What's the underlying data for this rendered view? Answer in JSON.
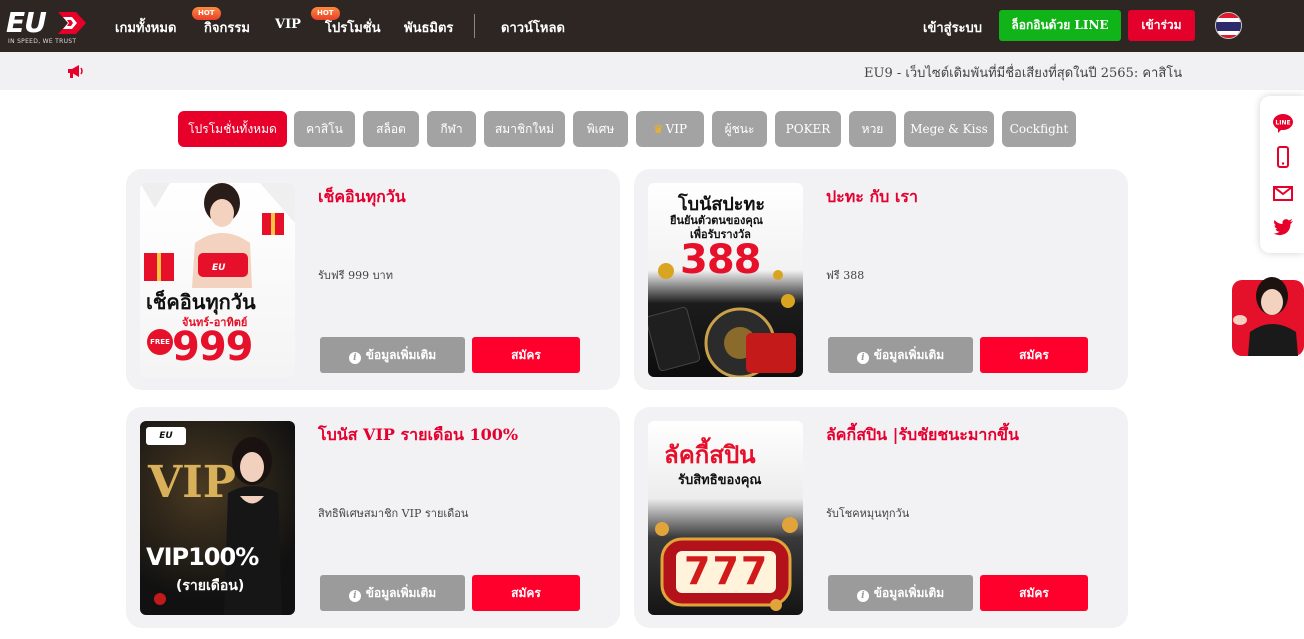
{
  "header": {
    "logo_text": "EU",
    "logo_tagline": "IN SPEED, WE TRUST",
    "nav": [
      {
        "label": "เกมทั้งหมด"
      },
      {
        "label": "กิจกรรม",
        "badge": "HOT"
      },
      {
        "label": "VIP"
      },
      {
        "label": "โปรโมชั่น",
        "badge": "HOT"
      },
      {
        "label": "พันธมิตร"
      },
      {
        "label": "ดาวน์โหลด"
      }
    ],
    "login_label": "เข้าสู่ระบบ",
    "line_login_label": "ล็อกอินด้วย LINE",
    "register_label": "เข้าร่วม",
    "language_icon": "thailand-flag-icon"
  },
  "announcement": {
    "icon": "megaphone-icon",
    "text": "EU9 - เว็บไซต์เดิมพันที่มีชื่อเสียงที่สุดในปี 2565: คาสิโน"
  },
  "filters": [
    {
      "label": "โปรโมชั่นทั้งหมด",
      "active": true
    },
    {
      "label": "คาสิโน"
    },
    {
      "label": "สล็อต"
    },
    {
      "label": "กีฬา"
    },
    {
      "label": "สมาชิกใหม่"
    },
    {
      "label": "พิเศษ"
    },
    {
      "label": "VIP",
      "icon": "crown-icon"
    },
    {
      "label": "ผู้ชนะ"
    },
    {
      "label": "POKER"
    },
    {
      "label": "หวย"
    },
    {
      "label": "Mege & Kiss"
    },
    {
      "label": "Cockfight"
    }
  ],
  "promotions": [
    {
      "title": "เช็คอินทุกวัน",
      "description": "รับฟรี 999 บาท",
      "info_label": "ข้อมูลเพิ่มเติม",
      "apply_label": "สมัคร",
      "poster": {
        "brand": "EU",
        "headline": "เช็คอินทุกวัน",
        "sub": "จันทร์-อาทิตย์",
        "badge": "FREE",
        "amount": "999"
      }
    },
    {
      "title": "ปะทะ กับ เรา",
      "description": "ฟรี 388",
      "info_label": "ข้อมูลเพิ่มเติม",
      "apply_label": "สมัคร",
      "poster": {
        "headline": "โบนัสปะทะ",
        "line1": "ยืนยันตัวตนของคุณ",
        "line2": "เพื่อรับรางวัล",
        "amount": "388"
      }
    },
    {
      "title": "โบนัส VIP รายเดือน 100%",
      "description": "สิทธิพิเศษสมาชิก VIP รายเดือน",
      "info_label": "ข้อมูลเพิ่มเติม",
      "apply_label": "สมัคร",
      "poster": {
        "brand": "EU",
        "big": "VIP",
        "amount": "VIP100%",
        "sub": "(รายเดือน)"
      }
    },
    {
      "title": "ลัคกี้สปิน |รับชัยชนะมากขึ้น",
      "description": "รับโชคหมุนทุกวัน",
      "info_label": "ข้อมูลเพิ่มเติม",
      "apply_label": "สมัคร",
      "poster": {
        "headline": "ลัคกี้สปิน",
        "sub": "รับสิทธิของคุณ",
        "amount": "777"
      }
    }
  ],
  "sidebar": {
    "icons": [
      "line-icon",
      "phone-icon",
      "mail-icon",
      "twitter-icon"
    ],
    "line_text": "LINE"
  },
  "colors": {
    "header_bg": "#2d2622",
    "accent_red": "#e6002a",
    "line_green": "#10b418",
    "filter_grey": "#a3a3a3",
    "card_bg": "#f2f2f4"
  }
}
